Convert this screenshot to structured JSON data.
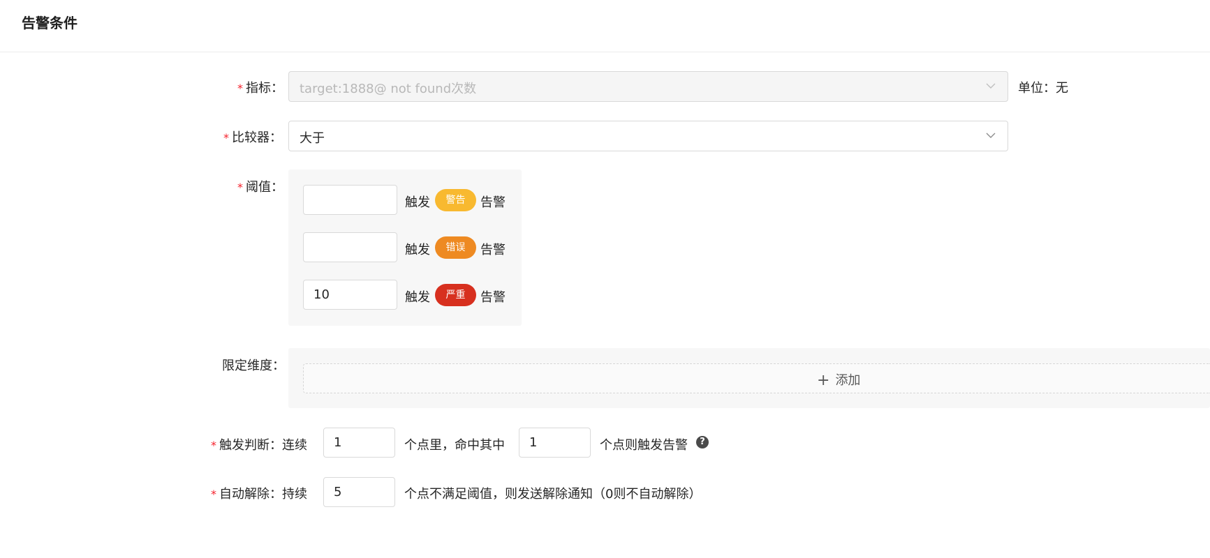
{
  "header": {
    "title": "告警条件"
  },
  "metric": {
    "label": "指标：",
    "value": "target:1888@ not found次数",
    "unit": "单位：无"
  },
  "comparator": {
    "label": "比较器：",
    "value": "大于"
  },
  "threshold": {
    "label": "阈值：",
    "rows": [
      {
        "value": "",
        "trigger": "触发",
        "level": "警告",
        "level_color": "#f8b930",
        "suffix": "告警"
      },
      {
        "value": "",
        "trigger": "触发",
        "level": "错误",
        "level_color": "#ee8a22",
        "suffix": "告警"
      },
      {
        "value": "10",
        "trigger": "触发",
        "level": "严重",
        "level_color": "#d7301f",
        "suffix": "告警"
      }
    ]
  },
  "dimension": {
    "label": "限定维度：",
    "add_label": "添加"
  },
  "trigger_judge": {
    "label": "触发判断：",
    "prefix": "连续",
    "points": "1",
    "middle": "个点里，命中其中",
    "hits": "1",
    "suffix": "个点则触发告警",
    "help_icon": "question-circle-icon"
  },
  "auto_resolve": {
    "label": "自动解除：",
    "prefix": "持续",
    "points": "5",
    "suffix": "个点不满足阈值，则发送解除通知（0则不自动解除）"
  }
}
